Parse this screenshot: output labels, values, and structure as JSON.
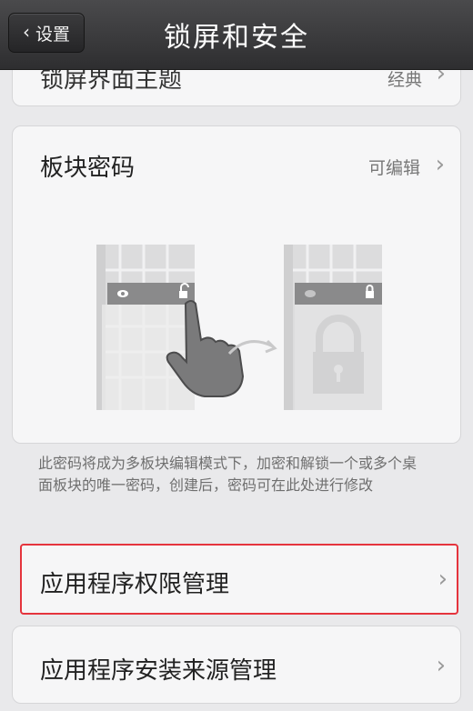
{
  "header": {
    "back_label": "设置",
    "title": "锁屏和安全"
  },
  "lock_theme": {
    "label": "锁屏界面主题",
    "value": "经典"
  },
  "block_password": {
    "label": "板块密码",
    "value": "可编辑",
    "description": "此密码将成为多板块编辑模式下，加密和解锁一个或多个桌面板块的唯一密码，创建后，密码可在此处进行修改"
  },
  "app_permissions": {
    "label": "应用程序权限管理"
  },
  "app_install_source": {
    "label": "应用程序安装来源管理"
  }
}
